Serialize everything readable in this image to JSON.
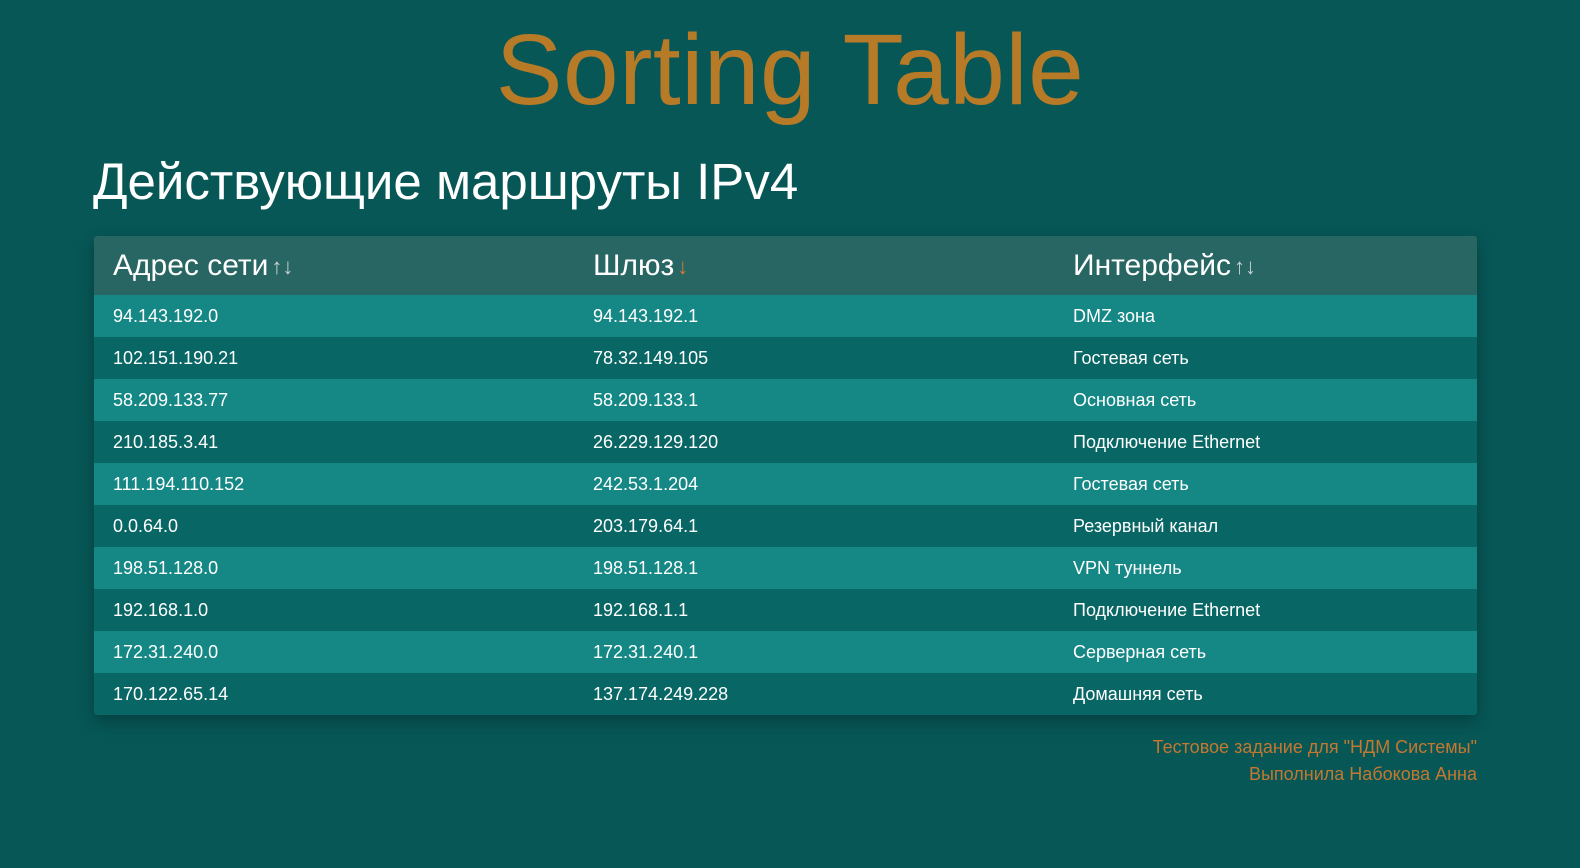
{
  "header": {
    "title": "Sorting Table",
    "subtitle": "Действующие маршруты IPv4"
  },
  "table": {
    "columns": [
      {
        "label": "Адрес сети",
        "sort_icon": "↑↓",
        "sort_state": "none"
      },
      {
        "label": "Шлюз",
        "sort_icon": "↓",
        "sort_state": "descending"
      },
      {
        "label": "Интерфейс",
        "sort_icon": "↑↓",
        "sort_state": "none"
      }
    ],
    "rows": [
      [
        "94.143.192.0",
        "94.143.192.1",
        "DMZ зона"
      ],
      [
        "102.151.190.21",
        "78.32.149.105",
        "Гостевая сеть"
      ],
      [
        "58.209.133.77",
        "58.209.133.1",
        "Основная сеть"
      ],
      [
        "210.185.3.41",
        "26.229.129.120",
        "Подключение Ethernet"
      ],
      [
        "111.194.110.152",
        "242.53.1.204",
        "Гостевая сеть"
      ],
      [
        "0.0.64.0",
        "203.179.64.1",
        "Резервный канал"
      ],
      [
        "198.51.128.0",
        "198.51.128.1",
        "VPN туннель"
      ],
      [
        "192.168.1.0",
        "192.168.1.1",
        "Подключение Ethernet"
      ],
      [
        "172.31.240.0",
        "172.31.240.1",
        "Серверная сеть"
      ],
      [
        "170.122.65.14",
        "137.174.249.228",
        "Домашняя сеть"
      ]
    ]
  },
  "footer": {
    "line1": "Тестовое задание для \"НДМ Системы\"",
    "line2": "Выполнила Набокова Анна"
  },
  "colors": {
    "background": "#075757",
    "title": "#b77a27",
    "header_row": "#286664",
    "row_odd": "#158886",
    "row_even": "#086665",
    "active_sort_arrow": "#d97a32",
    "footer_text": "#c4782f"
  }
}
